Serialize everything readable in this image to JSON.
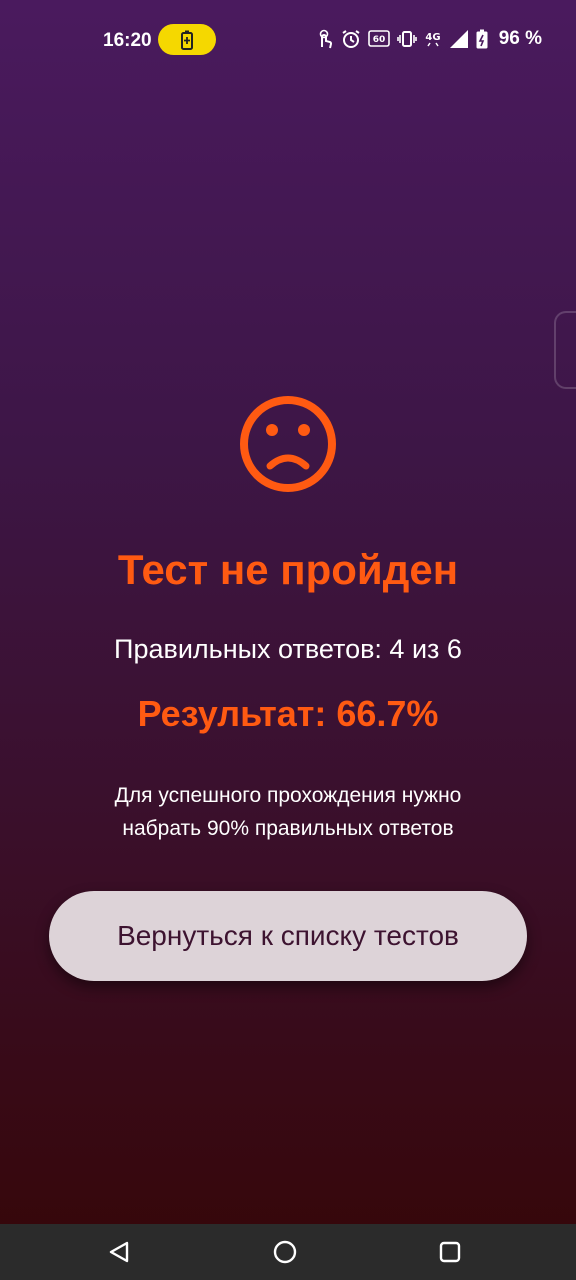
{
  "status_bar": {
    "time": "16:20",
    "battery_percent": "96 %",
    "icons": [
      "battery-saver-icon",
      "touch-icon",
      "alarm-icon",
      "refresh-rate-60hz-icon",
      "vibrate-icon",
      "network-4g-icon",
      "signal-icon",
      "battery-charging-icon"
    ]
  },
  "result_screen": {
    "icon": "sad-face-icon",
    "title": "Тест не пройден",
    "correct_answers": "Правильных ответов: 4 из 6",
    "score": "Результат: 66.7%",
    "hint_line1": "Для успешного прохождения нужно",
    "hint_line2": "набрать 90% правильных ответов",
    "back_button": "Вернуться к списку тестов"
  },
  "colors": {
    "accent": "#ff5a12",
    "button_bg": "#ddd3d8",
    "button_text": "#3d1330"
  },
  "nav_bar": {
    "buttons": [
      "back-icon",
      "home-icon",
      "recents-icon"
    ]
  }
}
